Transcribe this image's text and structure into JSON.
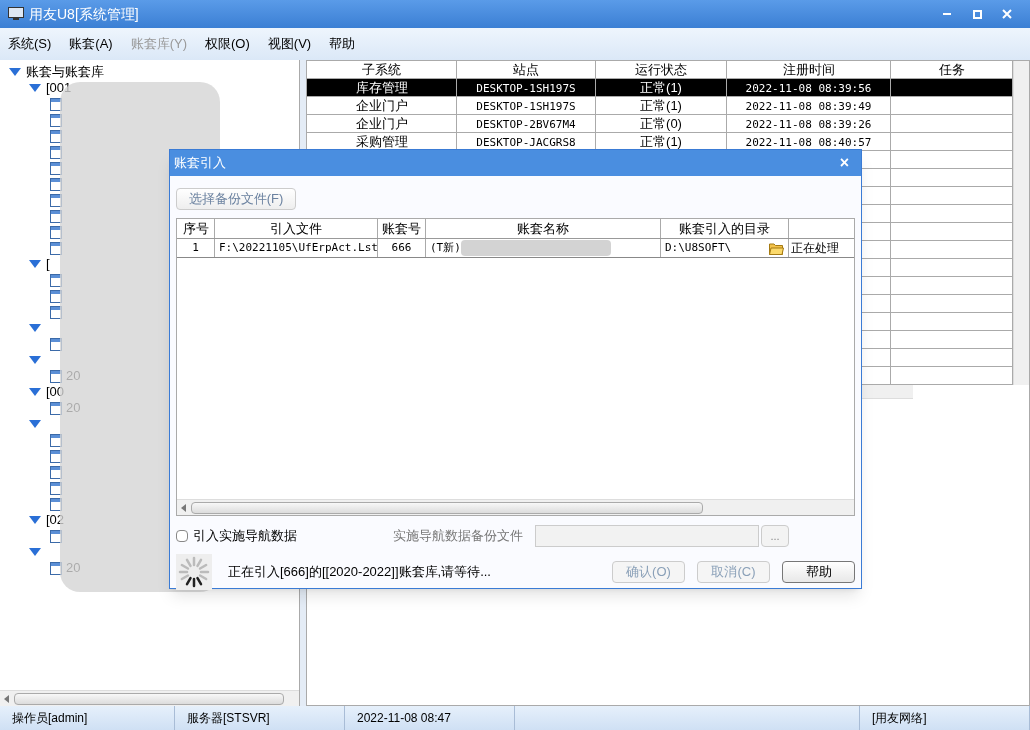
{
  "window": {
    "title": "用友U8[系统管理]"
  },
  "menu": [
    {
      "label": "系统(S)",
      "disabled": false
    },
    {
      "label": "账套(A)",
      "disabled": false
    },
    {
      "label": "账套库(Y)",
      "disabled": true
    },
    {
      "label": "权限(O)",
      "disabled": false
    },
    {
      "label": "视图(V)",
      "disabled": false
    },
    {
      "label": "帮助",
      "disabled": false
    }
  ],
  "tree": {
    "label": "账套与账套库",
    "expanded": true,
    "children": [
      {
        "label": "[001",
        "expanded": true,
        "children": [
          {
            "kind": "document"
          },
          {
            "kind": "document"
          },
          {
            "kind": "document"
          },
          {
            "kind": "document"
          },
          {
            "kind": "document"
          },
          {
            "kind": "document"
          },
          {
            "kind": "document"
          },
          {
            "kind": "document"
          },
          {
            "kind": "document"
          },
          {
            "kind": "document"
          }
        ]
      },
      {
        "label": "[",
        "expanded": true,
        "children": [
          {
            "kind": "document"
          },
          {
            "kind": "document"
          },
          {
            "kind": "document"
          }
        ]
      },
      {
        "expanded": true,
        "children": [
          {
            "kind": "document"
          }
        ]
      },
      {
        "expanded": true,
        "children": [
          {
            "kind": "document",
            "label": "20"
          }
        ]
      },
      {
        "label": "[00",
        "expanded": true,
        "children": [
          {
            "kind": "document",
            "label": "20"
          }
        ]
      },
      {
        "expanded": true,
        "children": [
          {
            "kind": "document"
          },
          {
            "kind": "document"
          },
          {
            "kind": "document"
          },
          {
            "kind": "document"
          },
          {
            "kind": "document"
          }
        ]
      },
      {
        "label": "[02",
        "expanded": true,
        "children": [
          {
            "kind": "document"
          }
        ]
      },
      {
        "expanded": true,
        "children": [
          {
            "kind": "document",
            "label": "20"
          }
        ]
      }
    ]
  },
  "sessions": {
    "columns": [
      "子系统",
      "站点",
      "运行状态",
      "注册时间",
      "任务"
    ],
    "rows": [
      {
        "selected": true,
        "cells": [
          "库存管理",
          "DESKTOP-1SH197S",
          "正常(1)",
          "2022-11-08 08:39:56"
        ]
      },
      {
        "selected": false,
        "cells": [
          "企业门户",
          "DESKTOP-1SH197S",
          "正常(1)",
          "2022-11-08 08:39:49"
        ]
      },
      {
        "selected": false,
        "cells": [
          "企业门户",
          "DESKTOP-2BV67M4",
          "正常(0)",
          "2022-11-08 08:39:26"
        ]
      },
      {
        "selected": false,
        "cells": [
          "采购管理",
          "DESKTOP-JACGRS8",
          "正常(1)",
          "2022-11-08 08:40:57"
        ]
      }
    ]
  },
  "dialog": {
    "title": "账套引入",
    "close": "×",
    "select_button": {
      "label": "选择备份文件(F)",
      "disabled": true
    },
    "columns": [
      "序号",
      "引入文件",
      "账套号",
      "账套名称",
      "账套引入的目录"
    ],
    "rows": [
      {
        "number": "1",
        "file": "F:\\20221105\\UfErpAct.Lst",
        "account_no": "666",
        "name": "(T新)",
        "directory": "D:\\U8SOFT\\",
        "status": "正在处理"
      }
    ],
    "nav_checkbox": {
      "label": "引入实施导航数据",
      "checked": false
    },
    "nav_file": {
      "label": "实施导航数据备份文件",
      "disabled": true,
      "browse": "..."
    },
    "message": "正在引入[666]的[[2020-2022]]账套库,请等待...",
    "buttons": [
      {
        "label": "确认(O)",
        "disabled": true
      },
      {
        "label": "取消(C)",
        "disabled": true
      },
      {
        "label": "帮助",
        "disabled": false
      }
    ]
  },
  "status_bar": [
    "操作员[admin]",
    "服务器[STSVR]",
    "2022-11-08 08:47",
    "[用友网络]"
  ]
}
